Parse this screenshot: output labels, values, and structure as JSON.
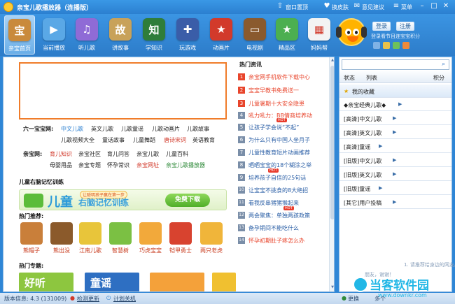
{
  "titlebar": {
    "title": "亲宝儿歌播放器（连播版）",
    "actions": [
      "窗口置顶",
      "换皮肤",
      "意见建议",
      "菜单"
    ]
  },
  "toolbar": {
    "tools": [
      {
        "label": "亲宝首页",
        "icon": "home-icon",
        "color": "#c98a3c",
        "glyph": "宝"
      },
      {
        "label": "当前播放",
        "icon": "play-icon",
        "color": "#5aa8e6",
        "glyph": "▶"
      },
      {
        "label": "听儿歌",
        "icon": "music-icon",
        "color": "#8f6bd6",
        "glyph": "♫"
      },
      {
        "label": "讲故事",
        "icon": "book-icon",
        "color": "#c8a25a",
        "glyph": "故"
      },
      {
        "label": "学知识",
        "icon": "knowledge-icon",
        "color": "#2f7d3a",
        "glyph": "知"
      },
      {
        "label": "玩游戏",
        "icon": "joystick-icon",
        "color": "#3a5da8",
        "glyph": "✚"
      },
      {
        "label": "动画片",
        "icon": "cartoon-icon",
        "color": "#d23a2b",
        "glyph": "★"
      },
      {
        "label": "电视剧",
        "icon": "tv-icon",
        "color": "#8a5a2e",
        "glyph": "▭"
      },
      {
        "label": "精品区",
        "icon": "star-icon",
        "color": "#4caf50",
        "glyph": "★"
      },
      {
        "label": "妈妈帮",
        "icon": "calendar-icon",
        "color": "#e9e9e9",
        "glyph": "▦"
      }
    ],
    "login_label": "登录",
    "register_label": "注册",
    "login_tip": "登录看节目连宝宝积分"
  },
  "categories": {
    "row1_head": "六一宝宝网:",
    "row1": [
      "中文儿歌",
      "英文儿歌",
      "儿歌童谣",
      "儿歌动画片",
      "儿歌故事"
    ],
    "row2": [
      "儿歌视频大全",
      "童话故事",
      "儿童舞蹈",
      "唐诗宋词",
      "英语教育"
    ],
    "row3_head": "亲宝网:",
    "row3": [
      "育儿知识",
      "亲宝社区",
      "育儿问答",
      "亲宝儿歌",
      "儿童百科"
    ],
    "row4": [
      "母婴用品",
      "亲宝专题",
      "怀孕常识",
      "亲宝网址",
      "亲宝儿歌播放器"
    ]
  },
  "sections": {
    "memory": "儿童右脑记忆训练",
    "recommend": "热门推荐:",
    "topics": "热门专题:",
    "news": "热门资讯"
  },
  "promo": {
    "big": "儿童",
    "mid": "右脑记忆训练",
    "tag": "让聪明孩子赢在第一步",
    "button": "免费下载"
  },
  "recommend": [
    {
      "label": "熊帽子",
      "color": "#c97f3a"
    },
    {
      "label": "熊出没",
      "color": "#8b5a2b"
    },
    {
      "label": "江南儿歌",
      "color": "#e8c53a"
    },
    {
      "label": "智慧树",
      "color": "#7bc043"
    },
    {
      "label": "巧虎宝宝",
      "color": "#f2a93b"
    },
    {
      "label": "铠甲勇士",
      "color": "#d8432f"
    },
    {
      "label": "两只老虎",
      "color": "#f0b53a"
    }
  ],
  "topics": [
    {
      "text": "好听",
      "color": "#8dc63f"
    },
    {
      "text": "童谣",
      "color": "#2e6fc2"
    },
    {
      "text": "",
      "color": "#f4a13a"
    },
    {
      "text": "",
      "color": "#f0c030"
    }
  ],
  "news": [
    {
      "num": "1",
      "text": "亲宝网手机软件下载中心",
      "num_color": "#e8452c",
      "text_color": "#e8452c",
      "hot": false
    },
    {
      "num": "2",
      "text": "宝宝早教书免费送一",
      "num_color": "#e8452c",
      "text_color": "#e8452c",
      "hot": false
    },
    {
      "num": "3",
      "text": "儿童暑期十大安全隐患",
      "num_color": "#e8452c",
      "text_color": "#e8452c",
      "hot": false
    },
    {
      "num": "4",
      "text": "吼力吼力：BB情商培养动",
      "num_color": "#7a8ea8",
      "text_color": "#e8452c",
      "hot": false
    },
    {
      "num": "5",
      "text": "让孩子学会说“不起”",
      "num_color": "#7a8ea8",
      "text_color": "#2b5fa6",
      "hot": true
    },
    {
      "num": "6",
      "text": "为什么只有中国人坐月子",
      "num_color": "#7a8ea8",
      "text_color": "#2b5fa6",
      "hot": false
    },
    {
      "num": "7",
      "text": "儿童性教育短片动画推荐",
      "num_color": "#7a8ea8",
      "text_color": "#2b5fa6",
      "hot": false
    },
    {
      "num": "8",
      "text": "晒晒宝宝的18个糊涂之举",
      "num_color": "#7a8ea8",
      "text_color": "#2b5fa6",
      "hot": false
    },
    {
      "num": "9",
      "text": "培养孩子自信的25句话",
      "num_color": "#7a8ea8",
      "text_color": "#2b5fa6",
      "hot": true
    },
    {
      "num": "10",
      "text": "让宝宝不挑食的8大绝招",
      "num_color": "#7a8ea8",
      "text_color": "#2b5fa6",
      "hot": false
    },
    {
      "num": "11",
      "text": "看我反串猪猪猴起来",
      "num_color": "#7a8ea8",
      "text_color": "#2b5fa6",
      "hot": false
    },
    {
      "num": "12",
      "text": "两会聚焦：单独两孩政策",
      "num_color": "#7a8ea8",
      "text_color": "#2b5fa6",
      "hot": true
    },
    {
      "num": "13",
      "text": "备孕期间不能吃什么",
      "num_color": "#7a8ea8",
      "text_color": "#2b5fa6",
      "hot": false
    },
    {
      "num": "14",
      "text": "怀孕初期肚子疼怎么办",
      "num_color": "#7a8ea8",
      "text_color": "#e8452c",
      "hot": false
    }
  ],
  "side": {
    "search_placeholder": "",
    "head": [
      "状态",
      "列表",
      "积分"
    ],
    "items": [
      "我的收藏",
      "◆亲宝经典儿歌◆",
      "[高清]中文儿歌",
      "[高清]英文儿歌",
      "[高清]童谣",
      "[旧版]中文儿歌",
      "[旧版]英文儿歌",
      "[旧版]童谣",
      "[其它]用户投稿"
    ],
    "tip1": "1. 请推荐给身边的网友/",
    "tip2": "朋友，谢谢！"
  },
  "status": {
    "version": "版本信息: 4.3 (131009)",
    "update": "检测更新",
    "shutdown": "计划关机",
    "skin": "更换",
    "chat": "多个"
  },
  "watermark": {
    "brand": "当客软件园",
    "url": "www.downkr.com"
  }
}
